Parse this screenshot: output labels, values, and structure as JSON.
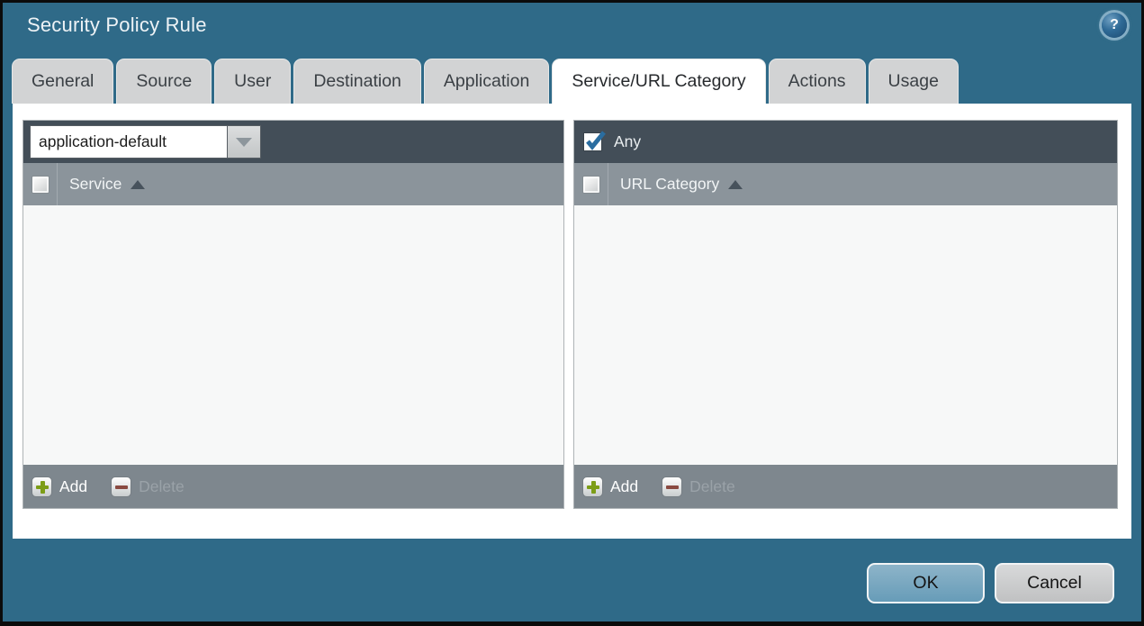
{
  "window": {
    "title": "Security Policy Rule"
  },
  "tabs": [
    {
      "label": "General",
      "active": false
    },
    {
      "label": "Source",
      "active": false
    },
    {
      "label": "User",
      "active": false
    },
    {
      "label": "Destination",
      "active": false
    },
    {
      "label": "Application",
      "active": false
    },
    {
      "label": "Service/URL Category",
      "active": true
    },
    {
      "label": "Actions",
      "active": false
    },
    {
      "label": "Usage",
      "active": false
    }
  ],
  "service_panel": {
    "dropdown": {
      "value": "application-default"
    },
    "header": {
      "column": "Service",
      "sort": "ascending",
      "checkbox_checked": false
    },
    "rows": [],
    "footer": {
      "add_label": "Add",
      "delete_label": "Delete",
      "delete_disabled": true
    }
  },
  "url_category_panel": {
    "any": {
      "label": "Any",
      "checked": true
    },
    "header": {
      "column": "URL Category",
      "sort": "ascending",
      "checkbox_checked": false
    },
    "rows": [],
    "footer": {
      "add_label": "Add",
      "delete_label": "Delete",
      "delete_disabled": true
    }
  },
  "actions": {
    "ok_label": "OK",
    "cancel_label": "Cancel"
  },
  "icons": {
    "help": "help-icon",
    "dropdown_arrow": "chevron-down-icon",
    "sort": "sort-ascending-icon",
    "add": "plus-icon",
    "delete": "minus-icon"
  },
  "colors": {
    "background_teal": "#2f6a88",
    "panel_top_bar": "#434e58",
    "panel_header": "#8b949b",
    "panel_footer": "#7e878e",
    "tab_inactive": "#d2d3d4",
    "tab_active": "#ffffff",
    "ok_button": "#6fa1bb",
    "cancel_button": "#c8c9ca",
    "add_plus_green": "#7c9d17",
    "delete_minus_red": "#8a4a41",
    "checkmark_blue": "#2a6da0"
  }
}
